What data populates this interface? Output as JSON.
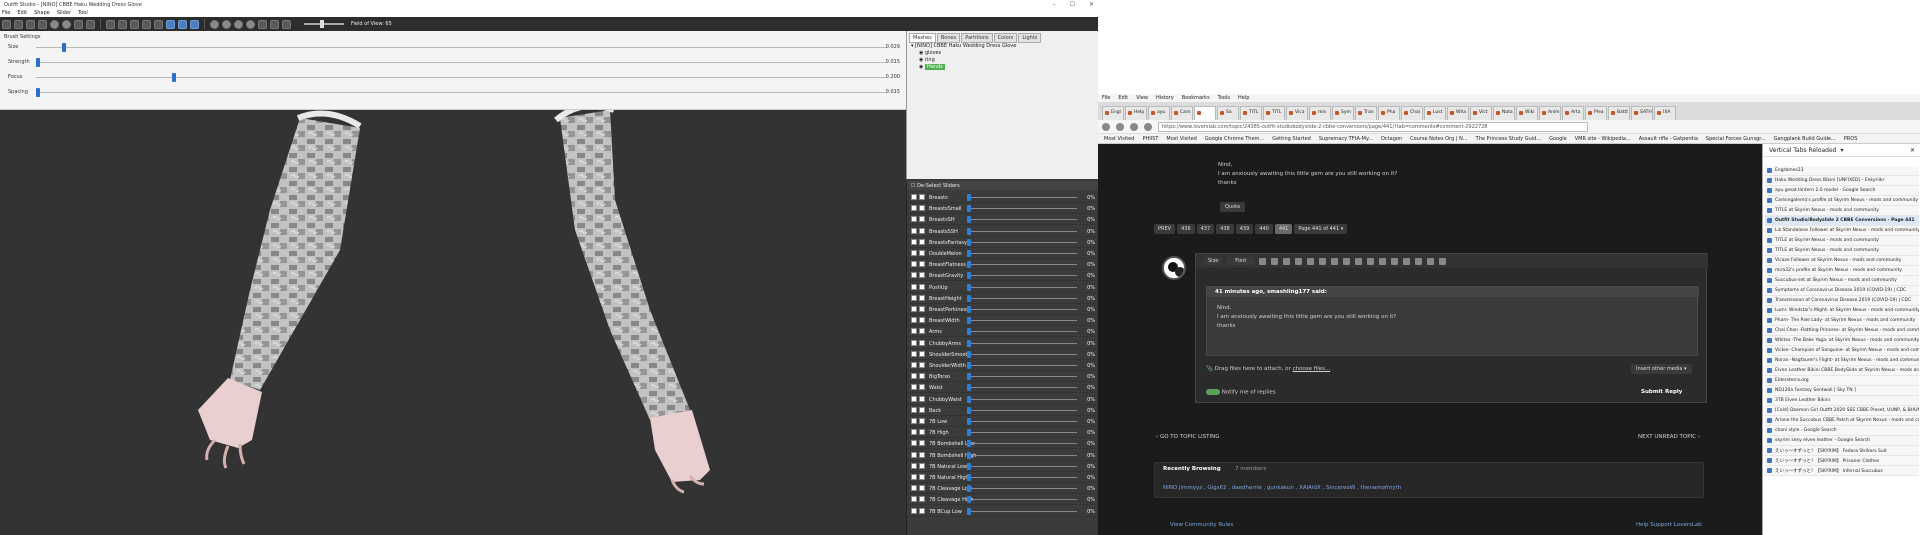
{
  "outfit_studio": {
    "title": "Outfit Studio - [NINO] CBBE Haku Wedding Dress Glove",
    "menu": [
      "File",
      "Edit",
      "Shape",
      "Slider",
      "Tool"
    ],
    "fov_label": "Field of View: 65",
    "brush": {
      "title": "Brush Settings",
      "rows": [
        {
          "label": "Size",
          "value": "0.029",
          "level": 0.03
        },
        {
          "label": "Strength",
          "value": "0.015",
          "level": 0.0
        },
        {
          "label": "Focus",
          "value": "0.200",
          "level": 0.16
        },
        {
          "label": "Spacing",
          "value": "0.015",
          "level": 0.0
        }
      ]
    },
    "side_tabs": [
      "Meshes",
      "Bones",
      "Partitions",
      "Colors",
      "Lights"
    ],
    "tree": {
      "root": "[NINO] CBBE Haku Wedding Dress Glove",
      "children": [
        "gloves",
        "ring",
        "Hands"
      ]
    },
    "slider_header": "De-Select Sliders",
    "sliders": [
      {
        "name": "Breasts",
        "pct": "0%"
      },
      {
        "name": "BreastsSmall",
        "pct": "0%"
      },
      {
        "name": "BreastsSH",
        "pct": "0%"
      },
      {
        "name": "BreastsSSH",
        "pct": "0%"
      },
      {
        "name": "BreastsFantasy",
        "pct": "0%"
      },
      {
        "name": "DoubleMelon",
        "pct": "0%"
      },
      {
        "name": "BreastFlatness",
        "pct": "0%"
      },
      {
        "name": "BreastGravity",
        "pct": "0%"
      },
      {
        "name": "PushUp",
        "pct": "0%"
      },
      {
        "name": "BreastHeight",
        "pct": "0%"
      },
      {
        "name": "BreastPerkiness",
        "pct": "0%"
      },
      {
        "name": "BreastWidth",
        "pct": "0%"
      },
      {
        "name": "Arms",
        "pct": "0%"
      },
      {
        "name": "ChubbyArms",
        "pct": "0%"
      },
      {
        "name": "ShoulderSmooth",
        "pct": "0%"
      },
      {
        "name": "ShoulderWidth",
        "pct": "0%"
      },
      {
        "name": "BigTorso",
        "pct": "0%"
      },
      {
        "name": "Waist",
        "pct": "0%"
      },
      {
        "name": "ChubbyWaist",
        "pct": "0%"
      },
      {
        "name": "Back",
        "pct": "0%"
      },
      {
        "name": "7B Low",
        "pct": "0%"
      },
      {
        "name": "7B High",
        "pct": "0%"
      },
      {
        "name": "7B Bombshell Low",
        "pct": "0%"
      },
      {
        "name": "7B Bombshell High",
        "pct": "0%"
      },
      {
        "name": "7B Natural Low",
        "pct": "0%"
      },
      {
        "name": "7B Natural High",
        "pct": "0%"
      },
      {
        "name": "7B Cleavage Low",
        "pct": "0%"
      },
      {
        "name": "7B Cleavage High",
        "pct": "0%"
      },
      {
        "name": "7B BCup Low",
        "pct": "0%"
      }
    ]
  },
  "browser": {
    "menu": [
      "File",
      "Edit",
      "View",
      "History",
      "Bookmarks",
      "Tools",
      "Help"
    ],
    "tabs": [
      "Engl",
      "Help",
      "ayu",
      "Carn",
      "",
      "Sa",
      "TITL",
      "TITL",
      "Vica",
      "mis",
      "Sym",
      "Tran",
      "Pha",
      "Chai",
      "Lust",
      "Wha",
      "Vict",
      "Nota",
      "Wiki",
      "Anim",
      "Arta",
      "Plea",
      "Battl",
      "SATH",
      "IXA"
    ],
    "url": "https://www.loverslab.com/topic/24385-outfit-studiobodyslide-2-cbbe-conversions/page/441/?tab=comments#comment-2922728",
    "bookmarks": [
      "Most Visited",
      "PHIIST",
      "Most Visited",
      "Google Chrome Them...",
      "Getting Started",
      "Supremacy TFtA-My...",
      "Octagon",
      "Course Notes Org | N...",
      "The Princess Study Guid...",
      "Google",
      "VMR site - Wikipedia...",
      "Assault rifle - Gatperdia",
      "Special Forces Gunsgr...",
      "Gangplank Build Guide...",
      "PROS"
    ],
    "post": {
      "line1": "Nind,",
      "line2": "I am anxiously awaiting this little gem are you still working on it?",
      "line3": "thanks",
      "quote_button": "Quote"
    },
    "pagination": {
      "prev": "PREV",
      "pages": [
        "436",
        "437",
        "438",
        "439",
        "440",
        "441"
      ],
      "current": "441",
      "page_of": "Page 441 of 441 ▾"
    },
    "editor": {
      "size_label": "Size",
      "font_label": "Font",
      "quote_head": "41 minutes ago, smashling177 said:",
      "attach_text": "Drag files here to attach, or",
      "choose_files": "choose files...",
      "insert_media": "Insert other media ▾",
      "notify": "Notify me of replies",
      "submit": "Submit Reply"
    },
    "nav": {
      "back": "GO TO TOPIC LISTING",
      "next": "NEXT UNREAD TOPIC"
    },
    "recent": {
      "title": "Recently Browsing",
      "count": "7 members",
      "members": "NINO  jimmyyz , Gigs62 , daedherrie , gunkakun , XAlAldX , SincereoW , thenamofmyth"
    },
    "footer": {
      "rules": "View Community Rules",
      "support": "Help Support LoversLab"
    },
    "vertical_tabs": {
      "title": "Vertical Tabs Reloaded",
      "items": [
        "Engrbmes23",
        "Haku Wedding Dress Bikini [UNFIXED] - Enkyriikr",
        "ayu great lantern 2.0 model - Google Search",
        "Carlsingalemo's profile at Skyrim Nexus - mods and community",
        "TITLE at Skyrim Nexus - mods and community",
        "Outfit Studio/Bodyslide 2 CBBE Conversions - Page 441",
        "Liz Standalone Follower at Skyrim Nexus - mods and community",
        "TITLE at Skyrim Nexus - mods and community",
        "TITLE at Skyrim Nexus - mods and community",
        "Vicaze Follower at Skyrim Nexus - mods and community",
        "mira32's profile at Skyrim Nexus - mods and community",
        "Succubus-set at Skyrim Nexus - mods and community",
        "Symptoms of Coronavirus Disease 2019 (COVID-19) | CDC",
        "Transmission of Coronavirus Disease 2019 (COVID-19) | CDC",
        "Lumi- Windstar's Might- at Skyrim Nexus - mods and community",
        "Pham- The Pale Lady- at Skyrim Nexus - mods and community",
        "Chai Chan -Rattling Princess- at Skyrim Nexus - mods and community",
        "Whites -The Bake Yaga- at Skyrim Nexus - mods and community",
        "Vickie- Champion of Sanguine- at Skyrim Nexus - mods and community",
        "Noran -Nagfaurer's Flight- at Skyrim Nexus - mods and community",
        "Elven Leather Bikini CBBE BodySlide at Skyrim Nexus - mods and community",
        "Eldersterra.org",
        "ND120a Fantasy Sentwall [ Sky TN ]",
        "3TB Elven Leather Bikini",
        "[Cold] Daemon Girl Outfit 2020 SSE CBBE Preset, UUNP, & BHUNP",
        "Ariane the Succubus CBBE Patch at Skyrim Nexus - mods and community",
        "choni style - Google Search",
        "skyrim sexy elven leather - Google Search",
        "えいっ〜すずっと！【SKYRIM】 Fedora Strikers Suit",
        "えいっ〜すずっと！【SKYRIM】 Prisoner Clothes",
        "えいっ〜すずっと！【SKYRIM】 Infernal Succubus"
      ],
      "active_index": 5
    }
  }
}
